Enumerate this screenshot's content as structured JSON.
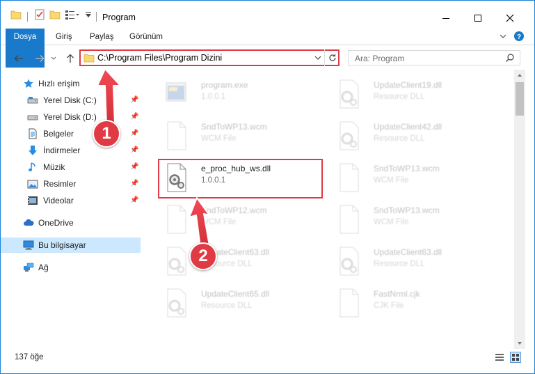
{
  "window": {
    "title": "Program",
    "minimize_icon": "minimize-icon",
    "maximize_icon": "maximize-icon",
    "close_icon": "close-icon"
  },
  "ribbon": {
    "tabs": [
      "Dosya",
      "Giriş",
      "Paylaş",
      "Görünüm"
    ]
  },
  "address": {
    "path": "C:\\Program Files\\Program Dizini"
  },
  "search": {
    "placeholder": "Ara: Program"
  },
  "sidebar": {
    "items": [
      {
        "label": "Hızlı erişim",
        "icon": "star-icon"
      },
      {
        "label": "Yerel Disk (C:)",
        "icon": "drive-icon"
      },
      {
        "label": "Yerel Disk (D:)",
        "icon": "drive-icon"
      },
      {
        "label": "Belgeler",
        "icon": "document-icon"
      },
      {
        "label": "İndirmeler",
        "icon": "download-icon"
      },
      {
        "label": "Müzik",
        "icon": "music-icon"
      },
      {
        "label": "Resimler",
        "icon": "pictures-icon"
      },
      {
        "label": "Videolar",
        "icon": "video-icon"
      },
      {
        "label": "OneDrive",
        "icon": "cloud-icon"
      },
      {
        "label": "Bu bilgisayar",
        "icon": "computer-icon"
      },
      {
        "label": "Ağ",
        "icon": "network-icon"
      }
    ]
  },
  "files": [
    {
      "name": "program.exe",
      "sub": "1.0.0.1"
    },
    {
      "name": "UpdateClient19.dll",
      "sub": "Resource DLL"
    },
    {
      "name": "SndToWP13.wcm",
      "sub": "WCM File"
    },
    {
      "name": "UpdateClient42.dll",
      "sub": "Resource DLL"
    },
    {
      "name": "e_proc_hub_ws.dll",
      "sub": "1.0.0.1"
    },
    {
      "name": "SndToWP13.wcm",
      "sub": "WCM File"
    },
    {
      "name": "SndToWP12.wcm",
      "sub": "WCM File"
    },
    {
      "name": "SndToWP13.wcm",
      "sub": "WCM File"
    },
    {
      "name": "UpdateClient63.dll",
      "sub": "Resource DLL"
    },
    {
      "name": "UpdateClient63.dll",
      "sub": "Resource DLL"
    },
    {
      "name": "UpdateClient65.dll",
      "sub": "Resource DLL"
    },
    {
      "name": "FastNrml.cjk",
      "sub": "CJK File"
    }
  ],
  "status": {
    "item_count": "137 öğe"
  },
  "callouts": [
    "1",
    "2"
  ],
  "colors": {
    "accent": "#1979ca",
    "highlight": "#e03a44",
    "selected": "#cce8ff"
  }
}
